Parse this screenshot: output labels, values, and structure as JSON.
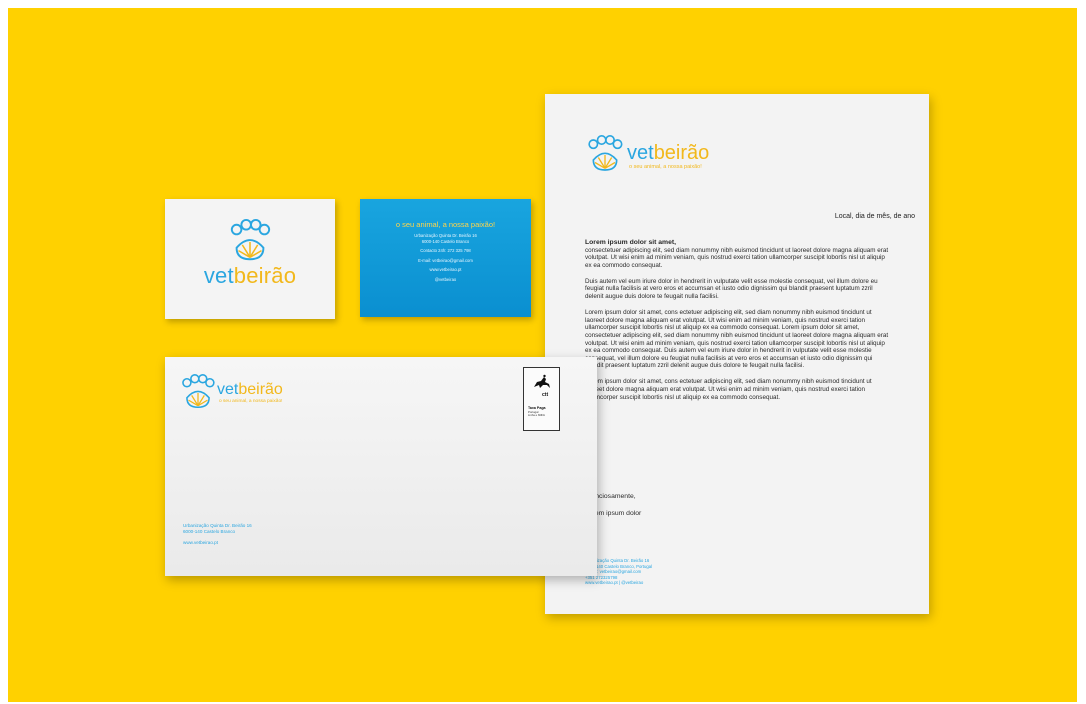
{
  "brand": {
    "vet": "vet",
    "beirao": "beirão",
    "tagline": "o seu animal, a nossa paixão!"
  },
  "colors": {
    "background": "#ffd100",
    "brand_blue": "#2aa6e0",
    "brand_yellow": "#f2b81c",
    "card_blue": "#0a8fd0"
  },
  "card_back": {
    "tagline": "o seu animal, a nossa paixão!",
    "address1": "Urbanização Quinta Dr. Beirão 16",
    "address2": "6000-140 Castelo Branco",
    "contact": "Contacto 24h: 272 325 798",
    "email": "E-mail: vetbeirao@gmail.com",
    "web": "www.vetbeirao.pt",
    "social": "@vetbeirao"
  },
  "letter": {
    "date_line": "Local, dia de mês, de ano",
    "greeting": "Lorem ipsum dolor sit amet,",
    "p1": "consectetuer adipiscing elit, sed diam nonummy nibh euismod tincidunt ut laoreet dolore magna aliquam erat volutpat. Ut wisi enim ad minim veniam, quis nostrud exerci tation ullamcorper suscipit lobortis nisl ut aliquip ex ea commodo consequat.",
    "p2": "Duis autem vel eum iriure dolor in hendrerit in vulputate velit esse molestie consequat, vel illum dolore eu feugiat nulla facilisis at vero eros et accumsan et iusto odio dignissim qui blandit praesent luptatum zzril delenit augue duis dolore te feugait nulla facilisi.",
    "p3": "Lorem ipsum dolor sit amet, cons ectetuer adipiscing elit, sed diam nonummy nibh euismod tincidunt ut laoreet dolore magna aliquam erat volutpat. Ut wisi enim ad minim veniam, quis nostrud exerci tation ullamcorper suscipit lobortis nisl ut aliquip ex ea commodo consequat. Lorem ipsum dolor sit amet, consectetuer adipiscing elit, sed diam nonummy nibh euismod tincidunt ut laoreet dolore magna aliquam erat volutpat. Ut wisi enim ad minim veniam, quis nostrud exerci tation ullamcorper suscipit lobortis nisl ut aliquip ex ea commodo consequat. Duis autem vel eum iriure dolor in hendrerit in vulputate velit esse molestie consequat, vel illum dolore eu feugiat nulla facilisis at vero eros et accumsan et iusto odio dignissim qui blandit praesent luptatum zzril delenit augue duis dolore te feugait nulla facilisi.",
    "p4": "Lorem ipsum dolor sit amet, cons ectetuer adipiscing elit, sed diam nonummy nibh euismod tincidunt ut laoreet dolore magna aliquam erat volutpat. Ut wisi enim ad minim veniam, quis nostrud exerci tation ullamcorper suscipit lobortis nisl ut aliquip ex ea commodo consequat.",
    "closing": "Atenciosamente,",
    "signature": "Lorem ipsum dolor",
    "footer1": "Urbanização Quinta Dr. Beirão 16",
    "footer2": "6000-140 Castelo Branco, Portugal",
    "footer3": "E-mail: vetbeirao@gmail.com",
    "footer4": "+351 272325798",
    "footer5": "www.vetbeirao.pt | @vetbeirao"
  },
  "envelope": {
    "address1": "Urbanização Quinta Dr. Beirão 16",
    "address2": "6000-140 Castelo Branco",
    "web": "www.vetbeirao.pt",
    "stamp_brand": "ctt",
    "stamp_title": "Taxa Paga",
    "stamp_line1": "Portugal",
    "stamp_line2": "Linha e Milhã"
  }
}
